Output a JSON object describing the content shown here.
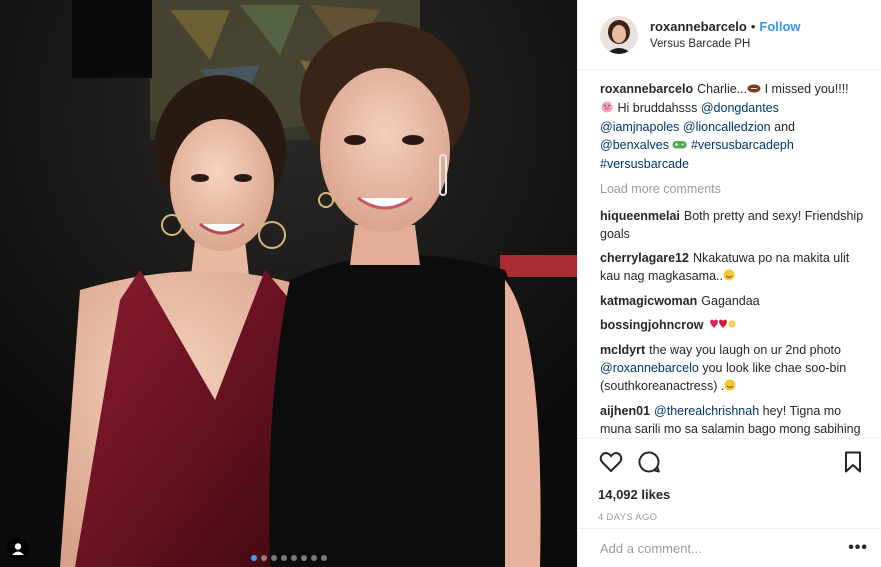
{
  "post": {
    "photo": {
      "alt": "",
      "active_index": 0,
      "count": 8
    },
    "tag_icon": "person-tag-icon"
  },
  "header": {
    "username": "roxannebarcelo",
    "separator": "•",
    "follow_label": "Follow",
    "location": "Versus Barcade PH"
  },
  "caption": {
    "username": "roxannebarcelo",
    "text_1": "Charlie...",
    "text_2": " I missed you!!!!",
    "text_3": " Hi bruddahsss ",
    "mentions": [
      "@dongdantes",
      "@iamjnapoles",
      "@lioncalledzion",
      "@benxalves"
    ],
    "and": " and ",
    "hashtags": [
      "#versusbarcadeph",
      "#versusbarcade"
    ]
  },
  "load_more_label": "Load more comments",
  "comments": [
    {
      "user": "hiqueenmelai",
      "text": "Both pretty and sexy! Friendship goals"
    },
    {
      "user": "cherrylagare12",
      "text": "Nkakatuwa po na makita ulit kau nag magkasama.."
    },
    {
      "user": "katmagicwoman",
      "text": "Gagandaa"
    },
    {
      "user": "bossingjohncrow",
      "text": ""
    },
    {
      "user": "mcldyrt",
      "text_1": "the way you laugh on ur 2nd photo ",
      "mention": "@roxannebarcelo",
      "text_2": " you look like chae soo-bin (southkoreanactress) ."
    },
    {
      "user": "aijhen01",
      "mention": "@therealchrishnah",
      "text": " hey! Tigna mo muna sarili mo sa salamin bago mong sabihing prang plaspag si natalie. Look at"
    }
  ],
  "actions": {
    "like_icon": "heart-icon",
    "comment_icon": "comment-icon",
    "save_icon": "bookmark-icon"
  },
  "likes": "14,092 likes",
  "time": "4 DAYS AGO",
  "add_comment": {
    "placeholder": "Add a comment...",
    "more_label": "•••"
  },
  "colors": {
    "accent": "#3897f0",
    "hashtag": "#003569",
    "muted": "#999999"
  }
}
